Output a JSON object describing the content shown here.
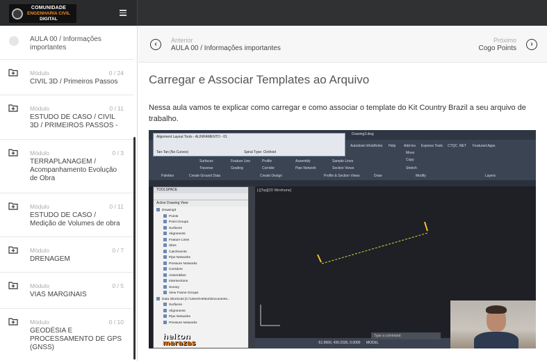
{
  "brand": {
    "line1": "COMUNIDADE",
    "line2": "ENGENHARIA CIVIL",
    "line3": "DIGITAL"
  },
  "sidebar": {
    "current_lesson": "AULA 00 / Informações importantes",
    "modules": [
      {
        "label": "Módulo",
        "count": "0 / 24",
        "title": "CIVIL 3D / Primeiros Passos"
      },
      {
        "label": "Módulo",
        "count": "0 / 11",
        "title": "ESTUDO DE CASO / CIVIL 3D / PRIMEIROS PASSOS -"
      },
      {
        "label": "Módulo",
        "count": "0 / 3",
        "title": "TERRAPLANAGEM / Acompanhamento Evolução de Obra"
      },
      {
        "label": "Módulo",
        "count": "0 / 11",
        "title": "ESTUDO DE CASO / Medição de Volumes de obra"
      },
      {
        "label": "Módulo",
        "count": "0 / 7",
        "title": "DRENAGEM"
      },
      {
        "label": "Módulo",
        "count": "0 / 5",
        "title": "VIAS MARGINAIS"
      },
      {
        "label": "Módulo",
        "count": "0 / 10",
        "title": "GEODÉSIA E PROCESSAMENTO DE GPS (GNSS)"
      }
    ]
  },
  "nav": {
    "prev_caption": "Anterior",
    "prev_title": "AULA 00 / Informações importantes",
    "next_caption": "Próximo",
    "next_title": "Cogo Points"
  },
  "lesson": {
    "title": "Carregar e Associar Templates ao Arquivo",
    "description": "Nessa aula vamos te explicar como carregar e como associar o template do Kit Country Brazil a seu arquivo de trabalho."
  },
  "video": {
    "popup_title": "Alignment Layout Tools - ALINHAMENTO - 01",
    "popup_left": "Tan-Tan (No Curves)",
    "popup_right": "Spiral Type: Clothoid",
    "drawing_tab": "Drawing3.dwg",
    "ribbon_items": [
      "Surfaces",
      "Feature Line",
      "Profile",
      "Assembly",
      "Sample Lines",
      "Move",
      "Copy",
      "Stretch",
      "Traverse",
      "Grading",
      "Corridor",
      "Pipe Network",
      "Section Views"
    ],
    "ribbon_groups": [
      "Palettes",
      "Create Ground Data",
      "Create Design",
      "Profile & Section Views",
      "Draw",
      "Modify",
      "Layers"
    ],
    "menu_items": [
      "Autodesk InfraWorks",
      "Help",
      "Add-ins",
      "Express Tools",
      "CTQC .NET",
      "Featured Apps"
    ],
    "toolspace_title": "TOOLSPACE",
    "toolspace_view": "Active Drawing View",
    "tree": [
      "Drawing3",
      "Points",
      "Point Groups",
      "Surfaces",
      "Alignments",
      "Feature Lines",
      "Sites",
      "Catchments",
      "Pipe Networks",
      "Pressure Networks",
      "Corridors",
      "Assemblies",
      "Intersections",
      "Survey",
      "View Frame Groups",
      "Data Shortcuts [C:\\Users\\Helton\\Documents...",
      "Surfaces",
      "Alignments",
      "Pipe Networks",
      "Pressure Networks"
    ],
    "viewport_label": "[-][Top][2D Wireframe]",
    "coords": "-51.9560, 430.2335, 0.0000",
    "model": "MODEL",
    "command": "Type a command",
    "presenter_brand_1": "helton",
    "presenter_brand_2": "marazas"
  }
}
